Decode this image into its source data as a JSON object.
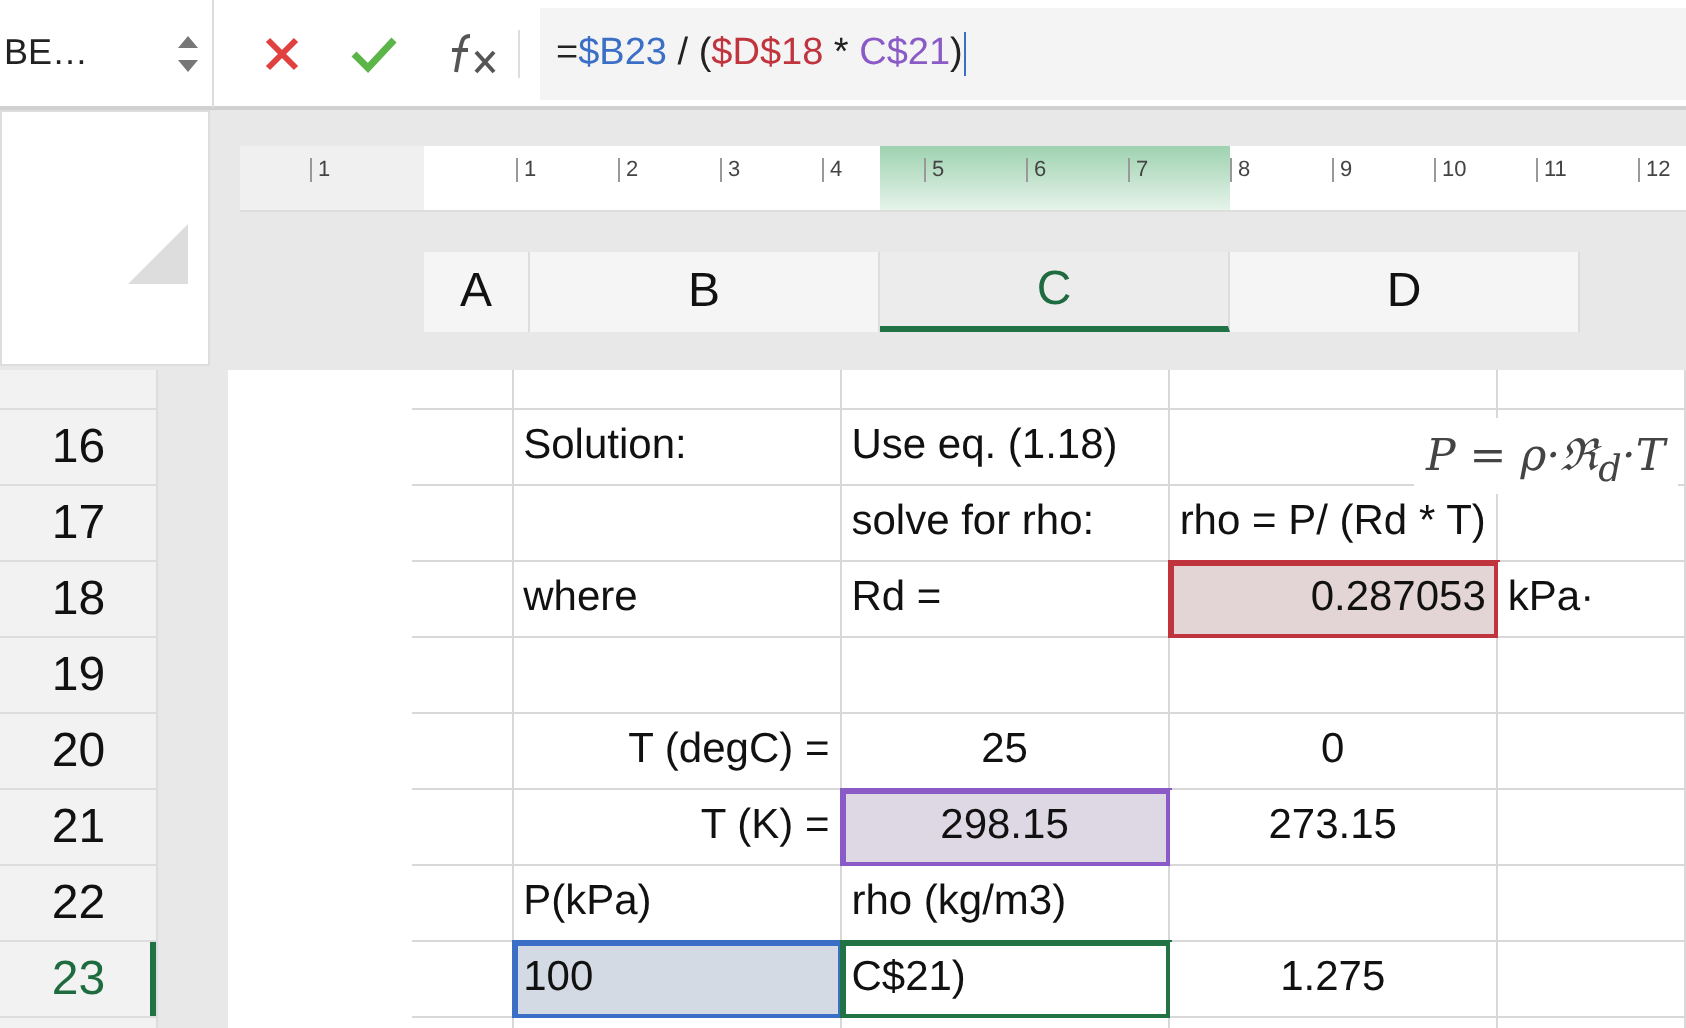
{
  "name_box": "BE…",
  "formula": [
    {
      "text": "=",
      "color": "#222222"
    },
    {
      "text": "$B23",
      "color": "#3b6fc6"
    },
    {
      "text": " / (",
      "color": "#222222"
    },
    {
      "text": "$D$18",
      "color": "#c0343e"
    },
    {
      "text": " * ",
      "color": "#222222"
    },
    {
      "text": "C$21",
      "color": "#8a5ac6"
    },
    {
      "text": ")",
      "color": "#222222"
    }
  ],
  "ruler": [
    "1",
    "1",
    "2",
    "3",
    "4",
    "5",
    "6",
    "7",
    "8",
    "9",
    "10",
    "11",
    "12"
  ],
  "columns": [
    {
      "label": "A",
      "selected": false
    },
    {
      "label": "B",
      "selected": false
    },
    {
      "label": "C",
      "selected": true
    },
    {
      "label": "D",
      "selected": false
    }
  ],
  "rows": [
    {
      "number": "16",
      "selected": false,
      "cells": [
        {
          "text": ""
        },
        {
          "text": "Solution:",
          "kind": "text"
        },
        {
          "text": "Use eq. (1.18)",
          "kind": "text"
        },
        {
          "text": ""
        },
        {
          "text": ""
        }
      ]
    },
    {
      "number": "17",
      "selected": false,
      "cells": [
        {
          "text": ""
        },
        {
          "text": ""
        },
        {
          "text": "solve for rho:",
          "kind": "text"
        },
        {
          "text": "rho = P/ (Rd * T)",
          "kind": "text"
        },
        {
          "text": ""
        }
      ]
    },
    {
      "number": "18",
      "selected": false,
      "cells": [
        {
          "text": ""
        },
        {
          "text": "where",
          "kind": "text"
        },
        {
          "text": "Rd =",
          "kind": "text"
        },
        {
          "text": "0.287053",
          "kind": "number",
          "color": "#c0343e"
        },
        {
          "text": "kPa·",
          "kind": "text"
        }
      ]
    },
    {
      "number": "19",
      "selected": false,
      "cells": [
        {
          "text": ""
        },
        {
          "text": ""
        },
        {
          "text": ""
        },
        {
          "text": ""
        },
        {
          "text": ""
        }
      ]
    },
    {
      "number": "20",
      "selected": false,
      "cells": [
        {
          "text": ""
        },
        {
          "text": "T (degC) =",
          "kind": "label"
        },
        {
          "text": "25",
          "kind": "value"
        },
        {
          "text": "0",
          "kind": "value"
        },
        {
          "text": ""
        }
      ]
    },
    {
      "number": "21",
      "selected": false,
      "cells": [
        {
          "text": ""
        },
        {
          "text": "T (K) =",
          "kind": "label"
        },
        {
          "text": "298.15",
          "kind": "value",
          "color": "#8a5ac6"
        },
        {
          "text": "273.15",
          "kind": "value"
        },
        {
          "text": ""
        }
      ]
    },
    {
      "number": "22",
      "selected": false,
      "cells": [
        {
          "text": ""
        },
        {
          "text": "P(kPa)",
          "kind": "text"
        },
        {
          "text": "rho (kg/m3)",
          "kind": "text"
        },
        {
          "text": ""
        },
        {
          "text": ""
        }
      ]
    },
    {
      "number": "23",
      "selected": true,
      "cells": [
        {
          "text": ""
        },
        {
          "text": "100",
          "kind": "text",
          "color": "#3b6fc6"
        },
        {
          "text": "C$21)",
          "kind": "text",
          "editing": true
        },
        {
          "text": "1.275",
          "kind": "value"
        },
        {
          "text": ""
        }
      ]
    }
  ],
  "equation": "P = ρ·ℜ$_{d}$·T"
}
